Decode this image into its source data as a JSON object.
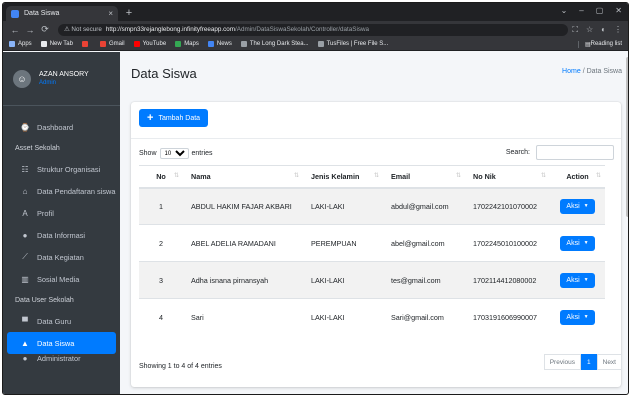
{
  "browser": {
    "tab_title": "Data Siswa",
    "tab_close": "×",
    "new_tab": "+",
    "window_controls": [
      "⌄",
      "–",
      "▢",
      "✕"
    ],
    "address": {
      "security": "⚠ Not secure",
      "host": "http://smpn33rejanglebong.infinityfreeapp.com",
      "path": "/Admin/DataSiswaSekolah/Controller/dataSiswa"
    },
    "bookmarks": [
      {
        "label": "Apps",
        "color": "#8ab4f8"
      },
      {
        "label": "New Tab",
        "color": "#e8eaed"
      },
      {
        "label": "",
        "color": "#ea4335"
      },
      {
        "label": "Gmail",
        "color": "#ea4335"
      },
      {
        "label": "YouTube",
        "color": "#ff0000"
      },
      {
        "label": "Maps",
        "color": "#34a853"
      },
      {
        "label": "News",
        "color": "#4285f4"
      },
      {
        "label": "The Long Dark Stea...",
        "color": "#9aa0a6"
      },
      {
        "label": "TusFiles | Free File S...",
        "color": "#9aa0a6"
      }
    ],
    "reading_list": "Reading list"
  },
  "sidebar": {
    "user_name": "AZAN ANSORY",
    "user_role": "Admin",
    "items": [
      {
        "type": "item",
        "label": "Dashboard",
        "icon": "⌚",
        "active": false
      },
      {
        "type": "header",
        "label": "Asset Sekolah"
      },
      {
        "type": "item",
        "label": "Struktur Organisasi",
        "icon": "☷",
        "active": false
      },
      {
        "type": "item",
        "label": "Data Pendaftaran siswa",
        "icon": "⌂",
        "active": false
      },
      {
        "type": "item",
        "label": "Profil",
        "icon": "A",
        "active": false
      },
      {
        "type": "item",
        "label": "Data Informasi",
        "icon": "●",
        "active": false
      },
      {
        "type": "item",
        "label": "Data Kegiatan",
        "icon": "⟋",
        "active": false
      },
      {
        "type": "item",
        "label": "Sosial Media",
        "icon": "▥",
        "active": false
      },
      {
        "type": "header",
        "label": "Data User Sekolah"
      },
      {
        "type": "item",
        "label": "Data Guru",
        "icon": "▀",
        "active": false
      },
      {
        "type": "item",
        "label": "Data Siswa",
        "icon": "▲",
        "active": true
      },
      {
        "type": "item",
        "label": "Administrator",
        "icon": "●",
        "active": false
      }
    ]
  },
  "page": {
    "title": "Data Siswa",
    "breadcrumb_home": "Home",
    "breadcrumb_sep": "/",
    "breadcrumb_current": "Data Siswa",
    "add_button": "Tambah Data",
    "show_label": "Show",
    "show_value": "10",
    "entries_label": "entries",
    "search_label": "Search:",
    "search_value": "",
    "columns": [
      "No",
      "Nama",
      "Jenis Kelamin",
      "Email",
      "No Nik",
      "Action"
    ],
    "rows": [
      {
        "no": "1",
        "nama": "ABDUL HAKIM FAJAR AKBARI",
        "jk": "LAKI-LAKI",
        "email": "abdul@gmail.com",
        "nik": "1702242101070002",
        "action": "Aksi"
      },
      {
        "no": "2",
        "nama": "ABEL ADELIA RAMADANI",
        "jk": "PEREMPUAN",
        "email": "abel@gmail.com",
        "nik": "1702245010100002",
        "action": "Aksi"
      },
      {
        "no": "3",
        "nama": "Adha isnana pirnansyah",
        "jk": "LAKI-LAKI",
        "email": "tes@gmail.com",
        "nik": "1702114412080002",
        "action": "Aksi"
      },
      {
        "no": "4",
        "nama": "Sari",
        "jk": "LAKI-LAKI",
        "email": "Sari@gmail.com",
        "nik": "1703191606990007",
        "action": "Aksi"
      }
    ],
    "info": "Showing 1 to 4 of 4 entries",
    "pager": {
      "previous": "Previous",
      "current": "1",
      "next": "Next"
    }
  },
  "colors": {
    "primary": "#007bff",
    "sidebar_bg": "#343a40"
  }
}
